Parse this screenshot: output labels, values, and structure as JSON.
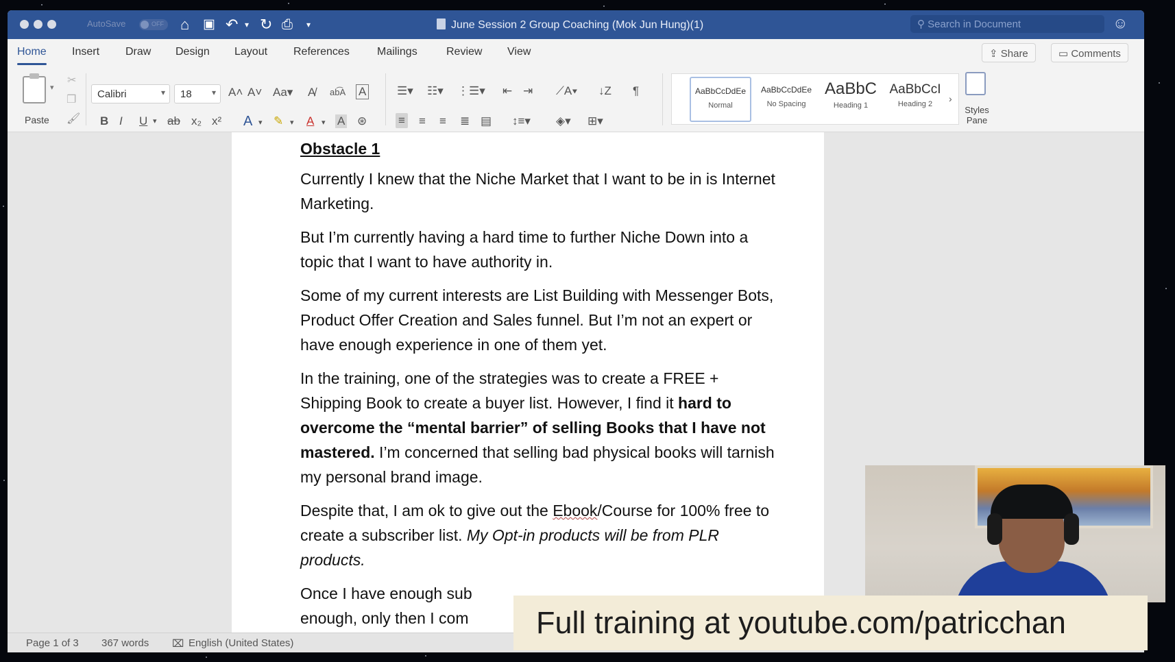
{
  "window": {
    "autosave_label": "AutoSave",
    "autosave_state": "OFF",
    "title": "June Session 2 Group Coaching (Mok Jun Hung)(1)",
    "search_placeholder": "Search in Document"
  },
  "ribbon_tabs": [
    {
      "label": "Home",
      "active": true
    },
    {
      "label": "Insert"
    },
    {
      "label": "Draw"
    },
    {
      "label": "Design"
    },
    {
      "label": "Layout"
    },
    {
      "label": "References"
    },
    {
      "label": "Mailings"
    },
    {
      "label": "Review"
    },
    {
      "label": "View"
    }
  ],
  "ribbon_actions": {
    "share": "Share",
    "comments": "Comments"
  },
  "ribbon": {
    "paste_label": "Paste",
    "font_name": "Calibri",
    "font_size": "18",
    "styles": [
      {
        "sample": "AaBbCcDdEe",
        "name": "Normal"
      },
      {
        "sample": "AaBbCcDdEe",
        "name": "No Spacing"
      },
      {
        "sample": "AaBbC",
        "name": "Heading 1"
      },
      {
        "sample": "AaBbCcI",
        "name": "Heading 2"
      }
    ],
    "styles_pane_label": "Styles Pane"
  },
  "document": {
    "heading": "Obstacle 1",
    "p1": "Currently I knew that the Niche Market that I want to be in is Internet Marketing.",
    "p2": "But I’m currently having a hard time to further Niche Down into a topic that I want to have authority in.",
    "p3": "Some of my current interests are List Building with Messenger Bots, Product Offer Creation and Sales funnel. But I’m not an expert or have enough experience in one of them yet.",
    "p4_start": "In the training, one of the strategies was to create a FREE + Shipping Book to create a buyer list. However, I find it ",
    "p4_bold": "hard to overcome the “mental barrier” of selling Books that I have not mastered.",
    "p4_end": " I’m concerned that selling bad physical books will tarnish my personal brand image.",
    "p5_start": "Despite that, I am ok to give out the ",
    "p5_ebook": "Ebook",
    "p5_mid": "/Course for 100% free to create a subscriber list. ",
    "p5_italic": "My Opt-in products will be from PLR products.",
    "p6_line1": "Once I have enough sub",
    "p6_line2": "enough, only then I com"
  },
  "status": {
    "page": "Page 1 of 3",
    "words": "367 words",
    "language": "English (United States)"
  },
  "banner": {
    "text": "Full training at youtube.com/patricchan"
  },
  "colors": {
    "titlebar": "#2f5596",
    "accent": "#2f5596",
    "banner_bg": "#f3ecd8"
  }
}
